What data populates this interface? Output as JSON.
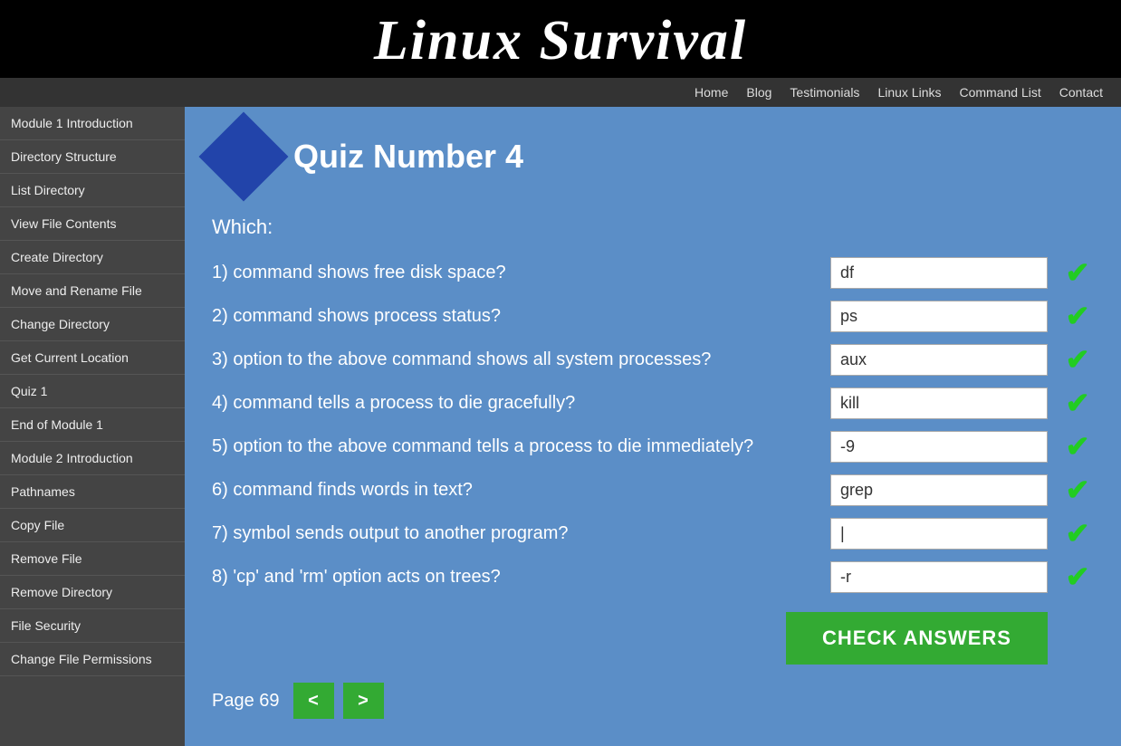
{
  "header": {
    "title": "Linux Survival"
  },
  "navbar": {
    "items": [
      {
        "label": "Home",
        "name": "nav-home"
      },
      {
        "label": "Blog",
        "name": "nav-blog"
      },
      {
        "label": "Testimonials",
        "name": "nav-testimonials"
      },
      {
        "label": "Linux Links",
        "name": "nav-linux-links"
      },
      {
        "label": "Command List",
        "name": "nav-command-list"
      },
      {
        "label": "Contact",
        "name": "nav-contact"
      }
    ]
  },
  "sidebar": {
    "items": [
      {
        "label": "Module 1 Introduction",
        "name": "sidebar-module1-intro"
      },
      {
        "label": "Directory Structure",
        "name": "sidebar-directory-structure"
      },
      {
        "label": "List Directory",
        "name": "sidebar-list-directory"
      },
      {
        "label": "View File Contents",
        "name": "sidebar-view-file-contents"
      },
      {
        "label": "Create Directory",
        "name": "sidebar-create-directory"
      },
      {
        "label": "Move and Rename File",
        "name": "sidebar-move-rename-file"
      },
      {
        "label": "Change Directory",
        "name": "sidebar-change-directory"
      },
      {
        "label": "Get Current Location",
        "name": "sidebar-get-current-location"
      },
      {
        "label": "Quiz 1",
        "name": "sidebar-quiz1"
      },
      {
        "label": "End of Module 1",
        "name": "sidebar-end-module1"
      },
      {
        "label": "Module 2 Introduction",
        "name": "sidebar-module2-intro"
      },
      {
        "label": "Pathnames",
        "name": "sidebar-pathnames"
      },
      {
        "label": "Copy File",
        "name": "sidebar-copy-file"
      },
      {
        "label": "Remove File",
        "name": "sidebar-remove-file"
      },
      {
        "label": "Remove Directory",
        "name": "sidebar-remove-directory"
      },
      {
        "label": "File Security",
        "name": "sidebar-file-security"
      },
      {
        "label": "Change File Permissions",
        "name": "sidebar-change-file-permissions"
      }
    ]
  },
  "main": {
    "quiz_title": "Quiz Number 4",
    "which_label": "Which:",
    "questions": [
      {
        "text": "1) command shows free disk space?",
        "answer": "df",
        "correct": true
      },
      {
        "text": "2) command shows process status?",
        "answer": "ps",
        "correct": true
      },
      {
        "text": "3) option to the above command shows all system processes?",
        "answer": "aux",
        "correct": true
      },
      {
        "text": "4) command tells a process to die gracefully?",
        "answer": "kill",
        "correct": true
      },
      {
        "text": "5) option to the above command tells a process to die immediately?",
        "answer": "-9",
        "correct": true
      },
      {
        "text": "6) command finds words in text?",
        "answer": "grep",
        "correct": true
      },
      {
        "text": "7) symbol sends output to another program?",
        "answer": "|",
        "correct": true
      },
      {
        "text": "8) 'cp' and 'rm' option acts on trees?",
        "answer": "-r",
        "correct": true
      }
    ],
    "check_answers_label": "CHECK ANSWERS",
    "pagination": {
      "page_label": "Page 69",
      "prev_label": "<",
      "next_label": ">"
    }
  }
}
